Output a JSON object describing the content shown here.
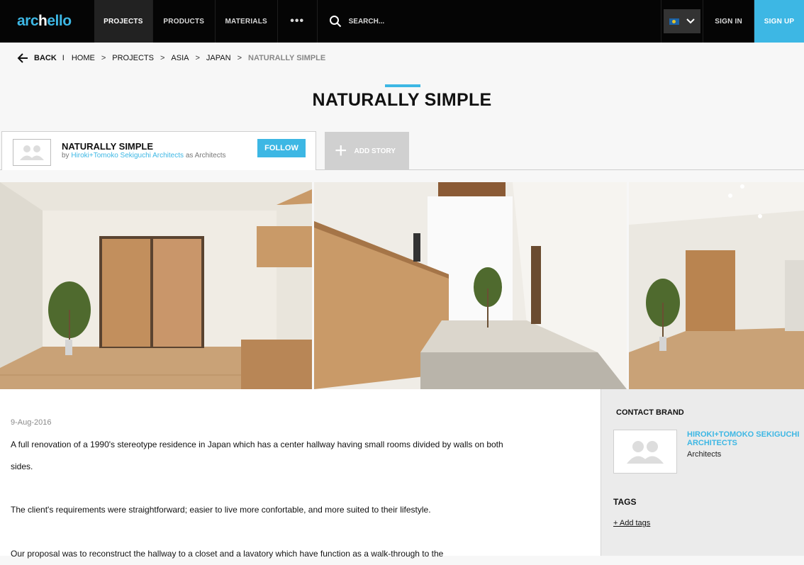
{
  "nav": {
    "logo_prefix": "arc",
    "logo_mid": "h",
    "logo_suffix": "ello",
    "projects": "PROJECTS",
    "products": "PRODUCTS",
    "materials": "MATERIALS",
    "more": "•••",
    "search_placeholder": "SEARCH...",
    "sign_in": "SIGN IN",
    "sign_up": "SIGN UP"
  },
  "breadcrumb": {
    "back": "BACK",
    "divider": "I",
    "items": [
      "HOME",
      "PROJECTS",
      "ASIA",
      "JAPAN"
    ],
    "separator": ">",
    "current": "NATURALLY SIMPLE"
  },
  "page": {
    "title": "NATURALLY SIMPLE"
  },
  "project_card": {
    "name": "NATURALLY SIMPLE",
    "by_prefix": "by",
    "author": "Hiroki+Tomoko Sekiguchi Architects",
    "role_suffix": "as Architects",
    "follow": "FOLLOW",
    "add_story": "ADD STORY"
  },
  "article": {
    "date": "9-Aug-2016",
    "paragraphs": [
      "A full renovation of a 1990's stereotype residence in Japan which has a center hallway having small rooms divided by walls on both sides.",
      "The client's requirements were straightforward; easier to live more confortable, and more suited to their lifestyle.",
      "Our proposal was to reconstruct the hallway to a closet and a lavatory which have function as a walk-through to the"
    ]
  },
  "sidebar": {
    "contact_heading": "CONTACT BRAND",
    "brand_name": "HIROKI+TOMOKO SEKIGUCHI ARCHITECTS",
    "brand_type": "Architects",
    "tags_heading": "TAGS",
    "add_tags": "+ Add tags"
  },
  "colors": {
    "accent": "#3db7e4",
    "nav_bg": "#050505"
  }
}
